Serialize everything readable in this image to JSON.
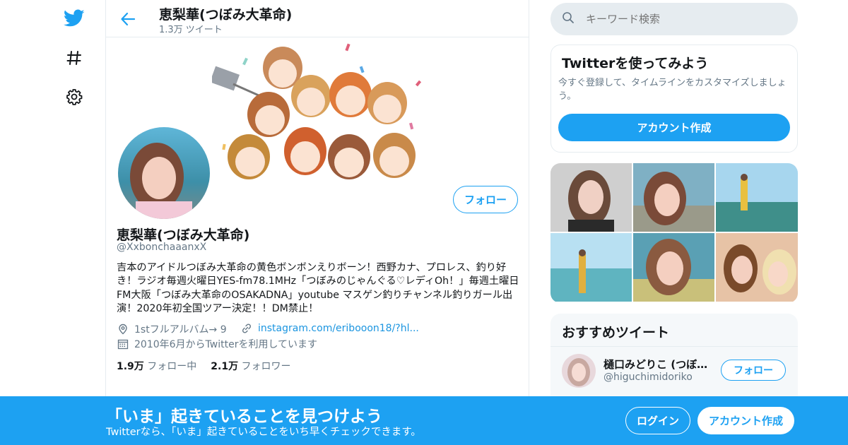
{
  "nav": {
    "icons": [
      "twitter-bird-icon",
      "hashtag-icon",
      "gear-icon"
    ]
  },
  "topbar": {
    "name": "恵梨華(つぼみ大革命)",
    "tweet_count": "1.3万 ツイート"
  },
  "profile": {
    "name": "恵梨華(つぼみ大革命)",
    "handle": "@XxbonchaaanxX",
    "follow_label": "フォロー",
    "bio": "吉本のアイドルつぼみ大革命の黄色ボンボンえりボーン！西野カナ、プロレス、釣り好き！ラジオ毎週火曜日YES-fm78.1MHz「つぼみのじゃんぐる♡レディOh！」毎週土曜日FM大阪「つぼみ大革命のOSAKADNA」youtube マスゲン釣りチャンネル釣りガール出演！2020年初全国ツアー決定！！DM禁止！",
    "location": "1stフルアルバム→ 9",
    "link": "instagram.com/eribooon18/?hl...",
    "joined": "2010年6月からTwitterを利用しています",
    "following_count": "1.9万",
    "following_label": "フォロー中",
    "followers_count": "2.1万",
    "followers_label": "フォロワー"
  },
  "search": {
    "placeholder": "キーワード検索"
  },
  "signup_card": {
    "title": "Twitterを使ってみよう",
    "text": "今すぐ登録して、タイムラインをカスタマイズしましょう。",
    "button": "アカウント作成"
  },
  "recommend": {
    "title": "おすすめツイート",
    "user_name": "樋口みどりこ (つぼみ...",
    "user_handle": "@higuchimidoriko",
    "follow_label": "フォロー"
  },
  "bottombar": {
    "title": "「いま」起きていることを見つけよう",
    "subtitle": "Twitterなら、「いま」起きていることをいち早くチェックできます。",
    "login": "ログイン",
    "signup": "アカウント作成"
  },
  "colors": {
    "brand": "#1da1f2",
    "muted_text": "#657786",
    "border": "#e6ecf0"
  }
}
